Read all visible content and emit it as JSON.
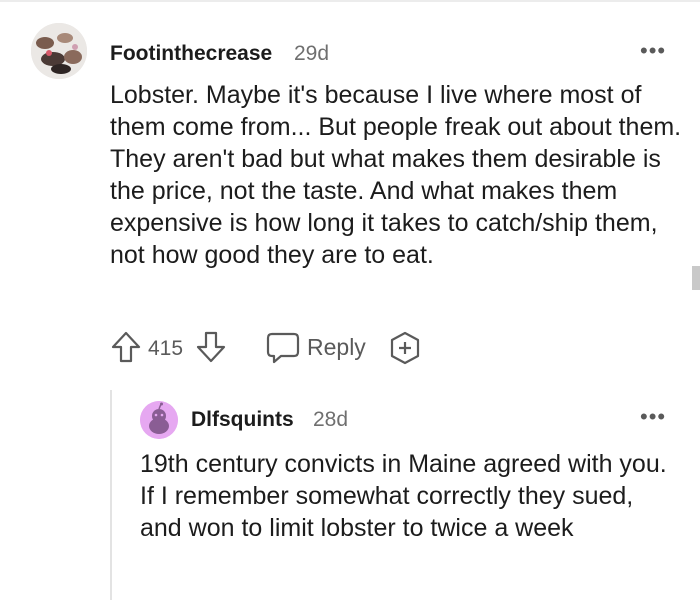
{
  "comment": {
    "username": "Footinthecrease",
    "timestamp": "29d",
    "body": "Lobster. Maybe it's because I live where most of them come from... But people freak out about them. They aren't bad but what makes them desirable is the price, not the taste. And what makes them expensive is how long it takes to catch/ship them, not how good they are to eat.",
    "votes": "415",
    "reply_label": "Reply",
    "icons": [
      "upvote-icon",
      "downvote-icon",
      "reply-bubble-icon",
      "award-icon",
      "more-options-icon"
    ]
  },
  "reply": {
    "username": "Dlfsquints",
    "timestamp": "28d",
    "body": "19th century convicts in Maine agreed with you. If I remember somewhat correctly they sued, and won to limit lobster to twice a week",
    "avatar_color": "#e6a8f1"
  }
}
